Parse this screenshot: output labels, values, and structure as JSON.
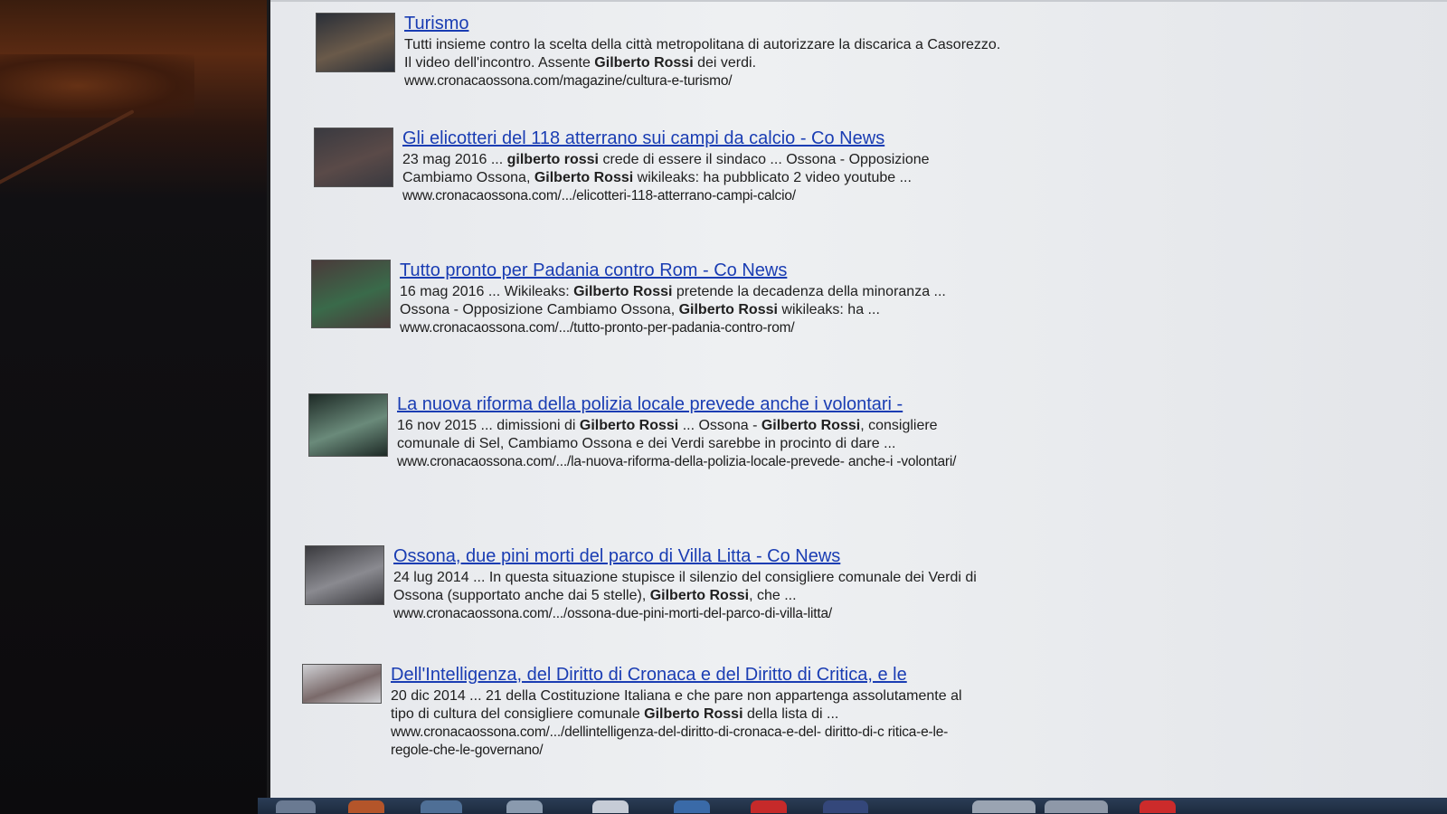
{
  "results": [
    {
      "title": "Turismo",
      "snippet_parts": [
        {
          "t": "Tutti insieme contro la scelta della città metropolitana di autorizzare la discarica a Casorezzo. Il video dell'incontro. Assente ",
          "b": false
        },
        {
          "t": "Gilberto Rossi",
          "b": true
        },
        {
          "t": " dei verdi.",
          "b": false
        }
      ],
      "url": "www.cronacaossona.com/magazine/cultura-e-turismo/",
      "thumb_colors": [
        "#2a2f38",
        "#6a5a4a"
      ]
    },
    {
      "title": "Gli elicotteri del 118 atterrano sui campi da calcio - Co News",
      "snippet_parts": [
        {
          "t": "23 mag 2016 ... ",
          "b": false
        },
        {
          "t": "gilberto rossi",
          "b": true
        },
        {
          "t": " crede di essere il sindaco ... Ossona - Opposizione Cambiamo Ossona, ",
          "b": false
        },
        {
          "t": "Gilberto Rossi",
          "b": true
        },
        {
          "t": " wikileaks: ha pubblicato 2 video youtube ...",
          "b": false
        }
      ],
      "url": "www.cronacaossona.com/.../elicotteri-118-atterrano-campi-calcio/",
      "thumb_colors": [
        "#3a3a40",
        "#5a4a48"
      ]
    },
    {
      "title": "Tutto pronto per Padania contro Rom - Co News",
      "snippet_parts": [
        {
          "t": "16 mag 2016 ... Wikileaks: ",
          "b": false
        },
        {
          "t": "Gilberto Rossi",
          "b": true
        },
        {
          "t": " pretende la decadenza della minoranza ... Ossona - Opposizione Cambiamo Ossona, ",
          "b": false
        },
        {
          "t": "Gilberto Rossi",
          "b": true
        },
        {
          "t": " wikileaks: ha ...",
          "b": false
        }
      ],
      "url": "www.cronacaossona.com/.../tutto-pronto-per-padania-contro-rom/",
      "thumb_colors": [
        "#4a3a3a",
        "#3a6a4a"
      ]
    },
    {
      "title": "La nuova riforma della polizia locale prevede anche i volontari -",
      "snippet_parts": [
        {
          "t": "16 nov 2015 ... dimissioni di ",
          "b": false
        },
        {
          "t": "Gilberto Rossi",
          "b": true
        },
        {
          "t": " ... Ossona - ",
          "b": false
        },
        {
          "t": "Gilberto Rossi",
          "b": true
        },
        {
          "t": ", consigliere comunale di Sel, Cambiamo Ossona e dei Verdi sarebbe in procinto di dare ...",
          "b": false
        }
      ],
      "url": "www.cronacaossona.com/.../la-nuova-riforma-della-polizia-locale-prevede- anche-i -volontari/",
      "thumb_colors": [
        "#1e2a26",
        "#6a8a7a"
      ]
    },
    {
      "title": "Ossona, due pini morti del parco di Villa Litta - Co News",
      "snippet_parts": [
        {
          "t": "24 lug 2014 ... In questa situazione stupisce il silenzio del consigliere comunale dei Verdi di Ossona (supportato anche dai 5 stelle), ",
          "b": false
        },
        {
          "t": "Gilberto Rossi",
          "b": true
        },
        {
          "t": ", che ...",
          "b": false
        }
      ],
      "url": "www.cronacaossona.com/.../ossona-due-pini-morti-del-parco-di-villa-litta/",
      "thumb_colors": [
        "#3a3a3e",
        "#8a8a90"
      ]
    },
    {
      "title": "Dell'Intelligenza, del Diritto di Cronaca e del Diritto di Critica, e le",
      "snippet_parts": [
        {
          "t": "20 dic 2014 ... 21 della Costituzione Italiana e che pare non appartenga assolutamente al tipo di cultura del consigliere comunale ",
          "b": false
        },
        {
          "t": "Gilberto Rossi",
          "b": true
        },
        {
          "t": " della lista di ...",
          "b": false
        }
      ],
      "url": "www.cronacaossona.com/.../dellintelligenza-del-diritto-di-cronaca-e-del- diritto-di-c ritica-e-le-regole-che-le-governano/",
      "thumb_colors": [
        "#cfd0d4",
        "#7a6a6a"
      ]
    }
  ]
}
